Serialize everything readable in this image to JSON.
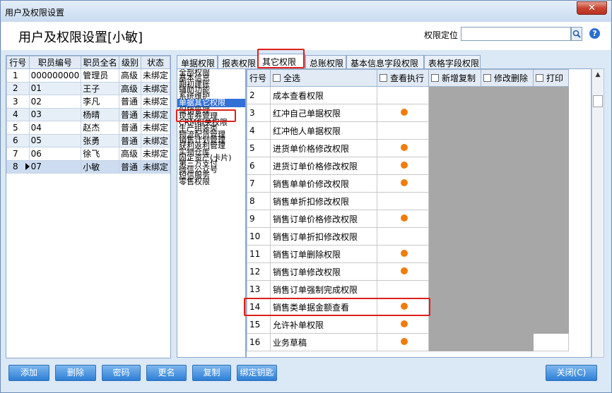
{
  "window": {
    "title": "用户及权限设置",
    "close_label": "✕"
  },
  "header": {
    "title": "用户及权限设置[小敏]",
    "locate_label": "权限定位",
    "locate_value": "",
    "help_label": "?"
  },
  "staff_table": {
    "columns": [
      "行号",
      "职员编号",
      "职员全名",
      "级别",
      "状态"
    ],
    "rows": [
      [
        "1",
        "000000000",
        "管理员",
        "高级",
        "未绑定"
      ],
      [
        "2",
        "01",
        "王子",
        "高级",
        "未绑定"
      ],
      [
        "3",
        "02",
        "李凡",
        "普通",
        "未绑定"
      ],
      [
        "4",
        "03",
        "杨晴",
        "普通",
        "未绑定"
      ],
      [
        "5",
        "04",
        "赵杰",
        "普通",
        "未绑定"
      ],
      [
        "6",
        "05",
        "张勇",
        "普通",
        "未绑定"
      ],
      [
        "7",
        "06",
        "徐飞",
        "高级",
        "未绑定"
      ],
      [
        "8",
        "07",
        "小敏",
        "普通",
        "未绑定"
      ]
    ],
    "selected_row": 8
  },
  "tabs": [
    {
      "label": "单据权限"
    },
    {
      "label": "报表权限"
    },
    {
      "label": "其它权限",
      "active": true
    },
    {
      "label": "总账权限"
    },
    {
      "label": "基本信息字段权限"
    },
    {
      "label": "表格字段权限"
    }
  ],
  "categories": [
    "全部权限",
    "基本信息",
    "期初建账",
    "辅助功能",
    "系统维护",
    "单据其它权限",
    "促销管理",
    "现金券管理",
    "CRM相关权限",
    "生产组装类",
    "物流配货管理",
    "销售计划管理",
    "获利返利管理",
    "实物仓库",
    "固定资产(卡片)",
    "第三方支付",
    "微信公众号",
    "短信服务",
    "零售权限"
  ],
  "selected_category": "单据其它权限",
  "grid": {
    "headers": {
      "rownum": "行号",
      "select_all": "全选",
      "view": "查看执行",
      "add": "新增复制",
      "edit": "修改删除",
      "print": "打印"
    },
    "rows": [
      {
        "no": "2",
        "name": "成本查看权限",
        "view": false
      },
      {
        "no": "3",
        "name": "红冲自己单据权限",
        "view": true
      },
      {
        "no": "4",
        "name": "红冲他人单据权限",
        "view": false
      },
      {
        "no": "5",
        "name": "进货单价格修改权限",
        "view": true
      },
      {
        "no": "6",
        "name": "进货订单价格修改权限",
        "view": true
      },
      {
        "no": "7",
        "name": "销售单单价修改权限",
        "view": true
      },
      {
        "no": "8",
        "name": "销售单折扣修改权限",
        "view": false
      },
      {
        "no": "9",
        "name": "销售订单价格修改权限",
        "view": true
      },
      {
        "no": "10",
        "name": "销售订单折扣修改权限",
        "view": false
      },
      {
        "no": "11",
        "name": "销售订单删除权限",
        "view": true
      },
      {
        "no": "12",
        "name": "销售订单修改权限",
        "view": true
      },
      {
        "no": "13",
        "name": "销售订单强制完成权限",
        "view": false
      },
      {
        "no": "14",
        "name": "销售类单据金额查看",
        "view": true
      },
      {
        "no": "15",
        "name": "允许补单权限",
        "view": true
      },
      {
        "no": "16",
        "name": "业务草稿",
        "view": true
      }
    ]
  },
  "buttons": {
    "add": "添加",
    "delete": "删除",
    "password": "密码",
    "rename": "更名",
    "copy": "复制",
    "bind": "绑定钥匙",
    "close": "关闭(C)"
  },
  "colors": {
    "highlight": "#e0201a",
    "dot": "#f07c0c",
    "selected": "#3370d6"
  }
}
